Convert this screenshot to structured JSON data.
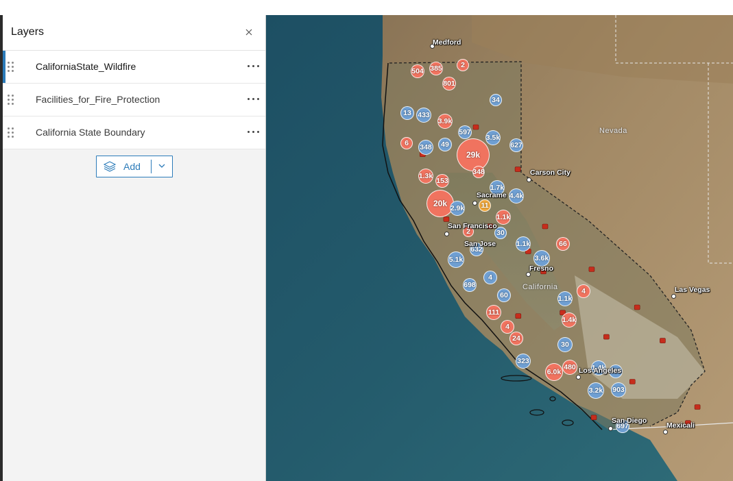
{
  "panel": {
    "title": "Layers",
    "layers": [
      {
        "label": "CaliforniaState_Wildfire",
        "active": true
      },
      {
        "label": "Facilities_for_Fire_Protection",
        "active": false
      },
      {
        "label": "California State Boundary",
        "active": false
      }
    ],
    "add_label": "Add"
  },
  "map": {
    "places": {
      "medford": "Medford",
      "nevada": "Nevada",
      "carson_city": "Carson City",
      "sacramento": "Sacrame",
      "san_francisco": "San Francisco",
      "san_jose": "San Jose",
      "fresno": "Fresno",
      "california": "California",
      "las_vegas": "Las Vegas",
      "los_angeles": "Los Angeles",
      "san_diego": "San Diego",
      "mexicali": "Mexicali"
    },
    "clusters": [
      {
        "label": "504",
        "type": "fire"
      },
      {
        "label": "385",
        "type": "fire"
      },
      {
        "label": "2",
        "type": "fire"
      },
      {
        "label": "801",
        "type": "fire"
      },
      {
        "label": "34",
        "type": "facility"
      },
      {
        "label": "13",
        "type": "facility"
      },
      {
        "label": "433",
        "type": "facility"
      },
      {
        "label": "3.9k",
        "type": "fire"
      },
      {
        "label": "597",
        "type": "facility"
      },
      {
        "label": "3.5k",
        "type": "facility"
      },
      {
        "label": "6",
        "type": "fire"
      },
      {
        "label": "348",
        "type": "facility"
      },
      {
        "label": "49",
        "type": "facility"
      },
      {
        "label": "627",
        "type": "facility"
      },
      {
        "label": "29k",
        "type": "fire"
      },
      {
        "label": "348",
        "type": "fire"
      },
      {
        "label": "1.3k",
        "type": "fire"
      },
      {
        "label": "153",
        "type": "fire"
      },
      {
        "label": "1.7k",
        "type": "facility"
      },
      {
        "label": "4.4k",
        "type": "facility"
      },
      {
        "label": "20k",
        "type": "fire"
      },
      {
        "label": "2.9k",
        "type": "facility"
      },
      {
        "label": "11",
        "type": "mixed"
      },
      {
        "label": "1.1k",
        "type": "fire"
      },
      {
        "label": "2",
        "type": "fire"
      },
      {
        "label": "30",
        "type": "facility"
      },
      {
        "label": "1.1k",
        "type": "facility"
      },
      {
        "label": "66",
        "type": "fire"
      },
      {
        "label": "632",
        "type": "facility"
      },
      {
        "label": "5.1k",
        "type": "facility"
      },
      {
        "label": "3.6k",
        "type": "facility"
      },
      {
        "label": "698",
        "type": "facility"
      },
      {
        "label": "4",
        "type": "facility"
      },
      {
        "label": "60",
        "type": "facility"
      },
      {
        "label": "4",
        "type": "fire"
      },
      {
        "label": "1.1k",
        "type": "facility"
      },
      {
        "label": "111",
        "type": "fire"
      },
      {
        "label": "1.4k",
        "type": "fire"
      },
      {
        "label": "4",
        "type": "fire"
      },
      {
        "label": "24",
        "type": "fire"
      },
      {
        "label": "30",
        "type": "facility"
      },
      {
        "label": "323",
        "type": "facility"
      },
      {
        "label": "480",
        "type": "fire"
      },
      {
        "label": "6.0k",
        "type": "fire"
      },
      {
        "label": "1.4k",
        "type": "facility"
      },
      {
        "label": "335",
        "type": "facility"
      },
      {
        "label": "3.2k",
        "type": "facility"
      },
      {
        "label": "903",
        "type": "facility"
      },
      {
        "label": "697",
        "type": "facility"
      }
    ]
  }
}
